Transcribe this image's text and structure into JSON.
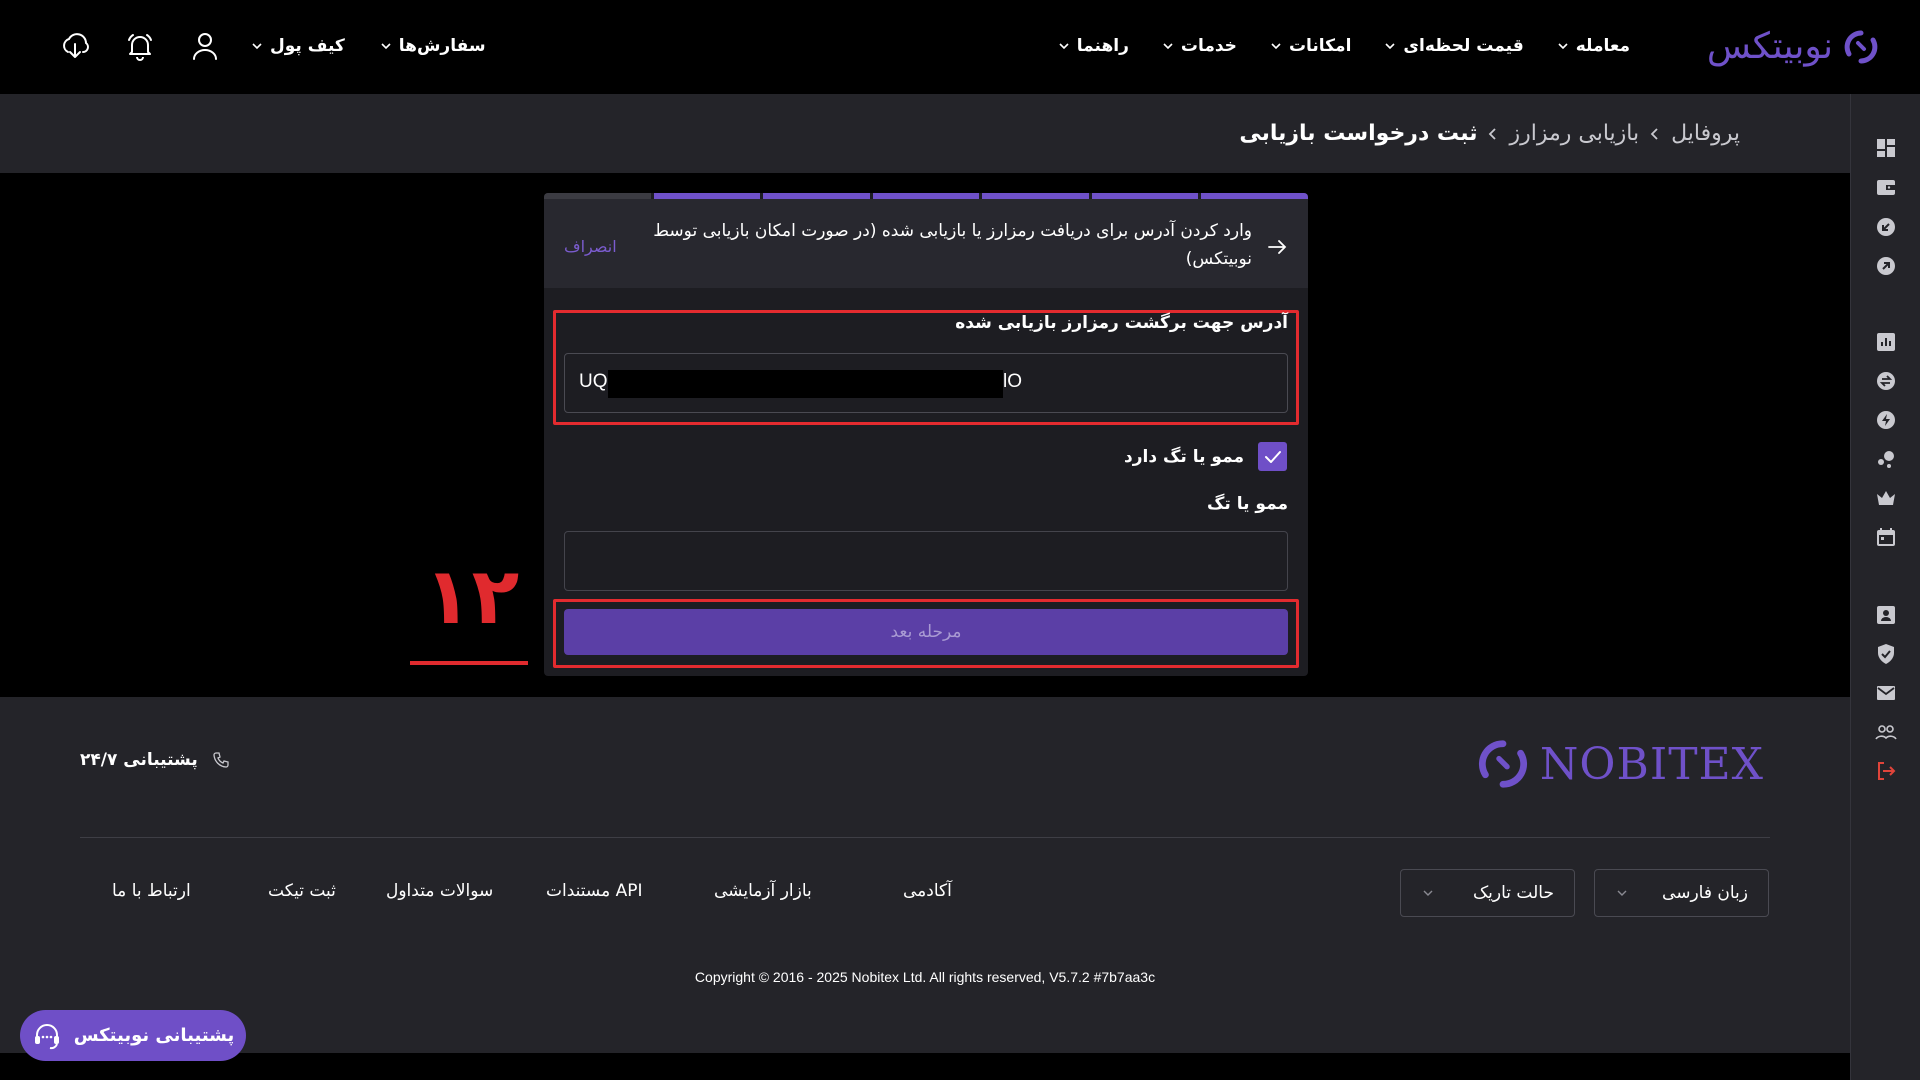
{
  "header": {
    "logo_text": "نوبیتکس",
    "nav": [
      {
        "label": "معامله"
      },
      {
        "label": "قیمت لحظه‌ای"
      },
      {
        "label": "امکانات"
      },
      {
        "label": "خدمات"
      },
      {
        "label": "راهنما"
      }
    ],
    "orders_label": "سفارش‌ها",
    "wallet_label": "کیف پول"
  },
  "breadcrumb": {
    "items": [
      "پروفایل",
      "بازیابی رمزارز"
    ],
    "current": "ثبت درخواست بازیابی"
  },
  "form": {
    "step_title": "وارد کردن آدرس برای دریافت رمزارز یا بازیابی شده (در صورت امکان بازیابی توسط نوبیتکس)",
    "cancel_label": "انصراف",
    "address_label": "آدرس جهت برگشت رمزارز بازیابی شده",
    "address_prefix": "UQ",
    "address_suffix": "lO",
    "memo_checkbox_label": "ممو یا تگ دارد",
    "memo_checked": true,
    "memo_label": "ممو یا تگ",
    "memo_value": "",
    "next_label": "مرحله بعد",
    "steps_total": 7,
    "steps_completed": 6
  },
  "annotation": {
    "text": "۱۲"
  },
  "footer": {
    "logo_text": "NOBITEX",
    "support_label": "پشتیبانی ۲۴/۷",
    "language_select": "زبان فارسی",
    "theme_select": "حالت تاریک",
    "links": [
      "آکادمی",
      "بازار آزمایشی",
      "مستندات API",
      "سوالات متداول",
      "ثبت تیکت",
      "ارتباط با ما"
    ],
    "copyright": "Copyright © 2016 - 2025 Nobitex Ltd. All rights reserved, V5.7.2 #7b7aa3c"
  },
  "support_pill": {
    "label": "پشتیبانی نوبیتکس"
  },
  "colors": {
    "brand": "#6f51c9",
    "highlight": "#e32b2f",
    "panel": "#242429",
    "card": "#1d1d22",
    "button": "#5b3fa6"
  }
}
